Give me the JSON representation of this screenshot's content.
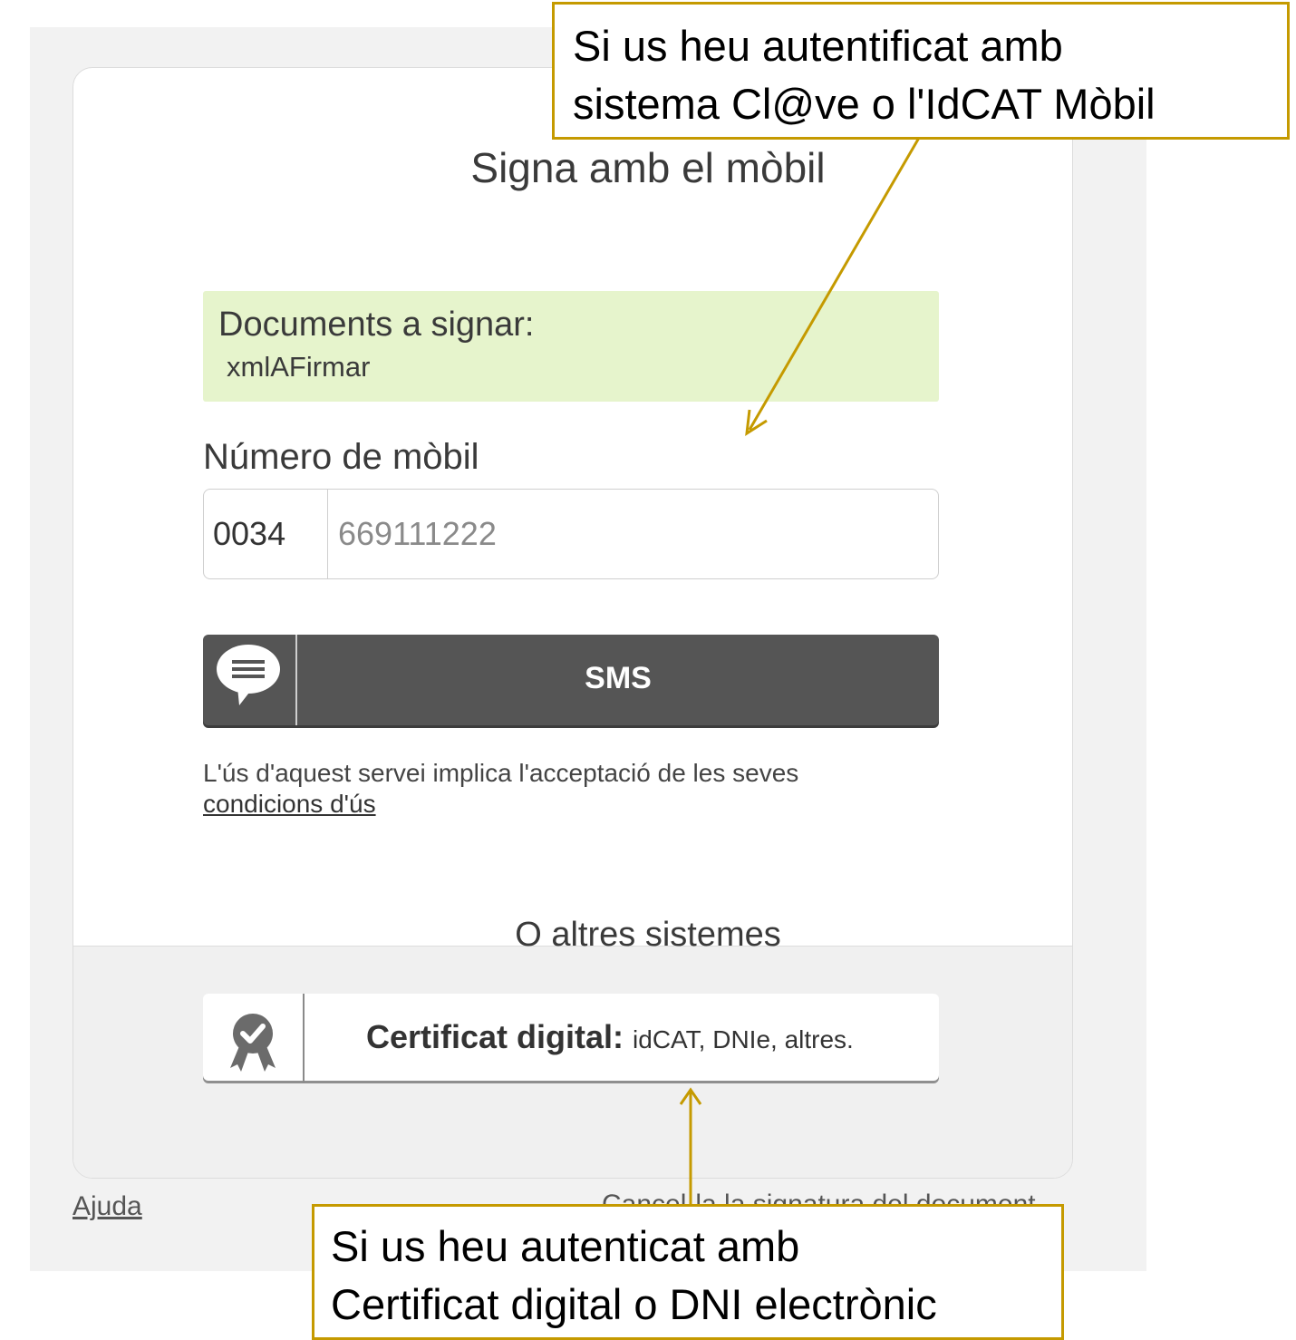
{
  "card": {
    "title": "Signa amb el mòbil",
    "documents_label": "Documents a signar:",
    "document_name": "xmlAFirmar"
  },
  "mobile": {
    "label": "Número de mòbil",
    "prefix": "0034",
    "placeholder": "669111222"
  },
  "sms_button": {
    "label": "SMS",
    "icon": "chat-bubble-icon"
  },
  "terms": {
    "text": "L'ús d'aquest servei implica l'acceptació de les seves",
    "link": "condicions d'ús"
  },
  "other": {
    "title": "O altres sistemes",
    "cert_bold": "Certificat digital:",
    "cert_rest": "idCAT, DNIe, altres.",
    "cert_icon": "award-badge-icon"
  },
  "footer": {
    "help": "Ajuda",
    "cancel": "Cancel·la la signatura del document"
  },
  "annotations": {
    "top_line1": "Si us heu autentificat amb",
    "top_line2": "sistema Cl@ve o l'IdCAT Mòbil",
    "bottom_line1": "Si us heu autenticat amb",
    "bottom_line2": "Certificat digital o DNI electrònic"
  },
  "colors": {
    "annotation": "#c59a00",
    "docs_bg": "#e6f4cc",
    "sms_bg": "#555555"
  }
}
